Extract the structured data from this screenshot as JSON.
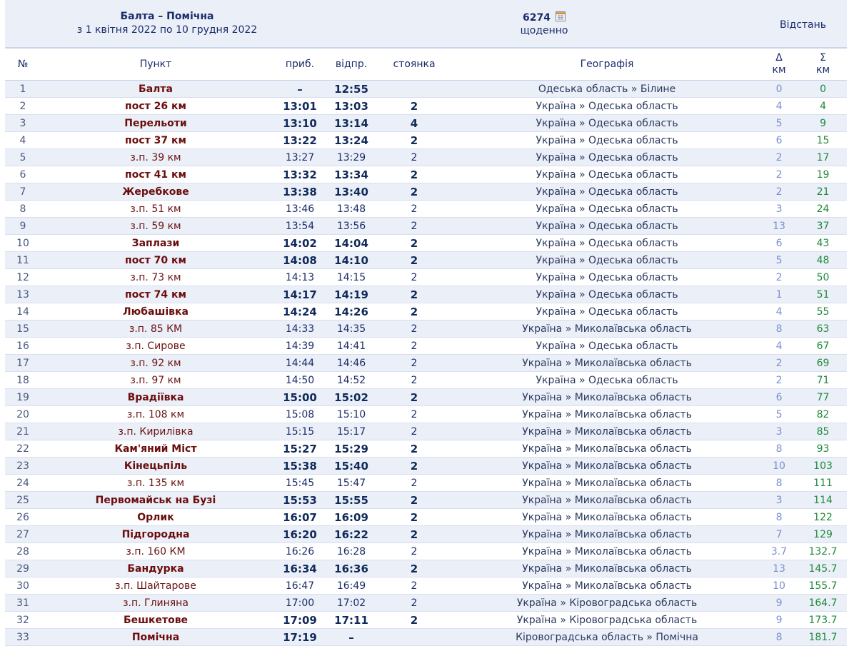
{
  "route": {
    "title": "Балта – Помічна",
    "period": "з 1 квітня 2022 по 10 грудня 2022"
  },
  "train": {
    "number": "6274",
    "frequency": "щоденно",
    "calendar_icon": "calendar-icon"
  },
  "distance_label": "Відстань",
  "columns": {
    "num": "№",
    "station": "Пункт",
    "arrive": "приб.",
    "depart": "відпр.",
    "stop": "стоянка",
    "geo": "Географія",
    "delta_symbol": "Δ",
    "delta_unit": "км",
    "total_symbol": "Σ",
    "total_unit": "км"
  },
  "colors": {
    "row_alt": "#ebeff8",
    "station": "#6b0d0d",
    "time": "#102a5a",
    "delta": "#7a8fd0",
    "total": "#1f8a3c"
  },
  "rows": [
    {
      "n": "1",
      "station": "Балта",
      "arr": "–",
      "dep": "12:55",
      "stop": "",
      "geo": "Одеська область » Білине",
      "d": "0",
      "t": "0",
      "major": true
    },
    {
      "n": "2",
      "station": "пост 26 км",
      "arr": "13:01",
      "dep": "13:03",
      "stop": "2",
      "geo": "Україна » Одеська область",
      "d": "4",
      "t": "4",
      "major": true
    },
    {
      "n": "3",
      "station": "Перельоти",
      "arr": "13:10",
      "dep": "13:14",
      "stop": "4",
      "geo": "Україна » Одеська область",
      "d": "5",
      "t": "9",
      "major": true
    },
    {
      "n": "4",
      "station": "пост 37 км",
      "arr": "13:22",
      "dep": "13:24",
      "stop": "2",
      "geo": "Україна » Одеська область",
      "d": "6",
      "t": "15",
      "major": true
    },
    {
      "n": "5",
      "station": "з.п. 39 км",
      "arr": "13:27",
      "dep": "13:29",
      "stop": "2",
      "geo": "Україна » Одеська область",
      "d": "2",
      "t": "17",
      "major": false
    },
    {
      "n": "6",
      "station": "пост 41 км",
      "arr": "13:32",
      "dep": "13:34",
      "stop": "2",
      "geo": "Україна » Одеська область",
      "d": "2",
      "t": "19",
      "major": true
    },
    {
      "n": "7",
      "station": "Жеребкове",
      "arr": "13:38",
      "dep": "13:40",
      "stop": "2",
      "geo": "Україна » Одеська область",
      "d": "2",
      "t": "21",
      "major": true
    },
    {
      "n": "8",
      "station": "з.п. 51 км",
      "arr": "13:46",
      "dep": "13:48",
      "stop": "2",
      "geo": "Україна » Одеська область",
      "d": "3",
      "t": "24",
      "major": false
    },
    {
      "n": "9",
      "station": "з.п. 59 км",
      "arr": "13:54",
      "dep": "13:56",
      "stop": "2",
      "geo": "Україна » Одеська область",
      "d": "13",
      "t": "37",
      "major": false
    },
    {
      "n": "10",
      "station": "Заплази",
      "arr": "14:02",
      "dep": "14:04",
      "stop": "2",
      "geo": "Україна » Одеська область",
      "d": "6",
      "t": "43",
      "major": true
    },
    {
      "n": "11",
      "station": "пост 70 км",
      "arr": "14:08",
      "dep": "14:10",
      "stop": "2",
      "geo": "Україна » Одеська область",
      "d": "5",
      "t": "48",
      "major": true
    },
    {
      "n": "12",
      "station": "з.п. 73 км",
      "arr": "14:13",
      "dep": "14:15",
      "stop": "2",
      "geo": "Україна » Одеська область",
      "d": "2",
      "t": "50",
      "major": false
    },
    {
      "n": "13",
      "station": "пост 74 км",
      "arr": "14:17",
      "dep": "14:19",
      "stop": "2",
      "geo": "Україна » Одеська область",
      "d": "1",
      "t": "51",
      "major": true
    },
    {
      "n": "14",
      "station": "Любашівка",
      "arr": "14:24",
      "dep": "14:26",
      "stop": "2",
      "geo": "Україна » Одеська область",
      "d": "4",
      "t": "55",
      "major": true
    },
    {
      "n": "15",
      "station": "з.п. 85 КМ",
      "arr": "14:33",
      "dep": "14:35",
      "stop": "2",
      "geo": "Україна » Миколаївська область",
      "d": "8",
      "t": "63",
      "major": false
    },
    {
      "n": "16",
      "station": "з.п. Сирове",
      "arr": "14:39",
      "dep": "14:41",
      "stop": "2",
      "geo": "Україна » Одеська область",
      "d": "4",
      "t": "67",
      "major": false
    },
    {
      "n": "17",
      "station": "з.п. 92 км",
      "arr": "14:44",
      "dep": "14:46",
      "stop": "2",
      "geo": "Україна » Миколаївська область",
      "d": "2",
      "t": "69",
      "major": false
    },
    {
      "n": "18",
      "station": "з.п. 97 км",
      "arr": "14:50",
      "dep": "14:52",
      "stop": "2",
      "geo": "Україна » Одеська область",
      "d": "2",
      "t": "71",
      "major": false
    },
    {
      "n": "19",
      "station": "Врадіївка",
      "arr": "15:00",
      "dep": "15:02",
      "stop": "2",
      "geo": "Україна » Миколаївська область",
      "d": "6",
      "t": "77",
      "major": true
    },
    {
      "n": "20",
      "station": "з.п. 108 км",
      "arr": "15:08",
      "dep": "15:10",
      "stop": "2",
      "geo": "Україна » Миколаївська область",
      "d": "5",
      "t": "82",
      "major": false
    },
    {
      "n": "21",
      "station": "з.п. Кирилівка",
      "arr": "15:15",
      "dep": "15:17",
      "stop": "2",
      "geo": "Україна » Миколаївська область",
      "d": "3",
      "t": "85",
      "major": false
    },
    {
      "n": "22",
      "station": "Кам'яний Міст",
      "arr": "15:27",
      "dep": "15:29",
      "stop": "2",
      "geo": "Україна » Миколаївська область",
      "d": "8",
      "t": "93",
      "major": true
    },
    {
      "n": "23",
      "station": "Кінецьпіль",
      "arr": "15:38",
      "dep": "15:40",
      "stop": "2",
      "geo": "Україна » Миколаївська область",
      "d": "10",
      "t": "103",
      "major": true
    },
    {
      "n": "24",
      "station": "з.п. 135 км",
      "arr": "15:45",
      "dep": "15:47",
      "stop": "2",
      "geo": "Україна » Миколаївська область",
      "d": "8",
      "t": "111",
      "major": false
    },
    {
      "n": "25",
      "station": "Первомайськ на Бузі",
      "arr": "15:53",
      "dep": "15:55",
      "stop": "2",
      "geo": "Україна » Миколаївська область",
      "d": "3",
      "t": "114",
      "major": true
    },
    {
      "n": "26",
      "station": "Орлик",
      "arr": "16:07",
      "dep": "16:09",
      "stop": "2",
      "geo": "Україна » Миколаївська область",
      "d": "8",
      "t": "122",
      "major": true
    },
    {
      "n": "27",
      "station": "Підгородна",
      "arr": "16:20",
      "dep": "16:22",
      "stop": "2",
      "geo": "Україна » Миколаївська область",
      "d": "7",
      "t": "129",
      "major": true
    },
    {
      "n": "28",
      "station": "з.п. 160 КМ",
      "arr": "16:26",
      "dep": "16:28",
      "stop": "2",
      "geo": "Україна » Миколаївська область",
      "d": "3.7",
      "t": "132.7",
      "major": false
    },
    {
      "n": "29",
      "station": "Бандурка",
      "arr": "16:34",
      "dep": "16:36",
      "stop": "2",
      "geo": "Україна » Миколаївська область",
      "d": "13",
      "t": "145.7",
      "major": true
    },
    {
      "n": "30",
      "station": "з.п. Шайтарове",
      "arr": "16:47",
      "dep": "16:49",
      "stop": "2",
      "geo": "Україна » Миколаївська область",
      "d": "10",
      "t": "155.7",
      "major": false
    },
    {
      "n": "31",
      "station": "з.п. Глиняна",
      "arr": "17:00",
      "dep": "17:02",
      "stop": "2",
      "geo": "Україна » Кіровоградська область",
      "d": "9",
      "t": "164.7",
      "major": false
    },
    {
      "n": "32",
      "station": "Бешкетове",
      "arr": "17:09",
      "dep": "17:11",
      "stop": "2",
      "geo": "Україна » Кіровоградська область",
      "d": "9",
      "t": "173.7",
      "major": true
    },
    {
      "n": "33",
      "station": "Помічна",
      "arr": "17:19",
      "dep": "–",
      "stop": "",
      "geo": "Кіровоградська область » Помічна",
      "d": "8",
      "t": "181.7",
      "major": true
    }
  ]
}
